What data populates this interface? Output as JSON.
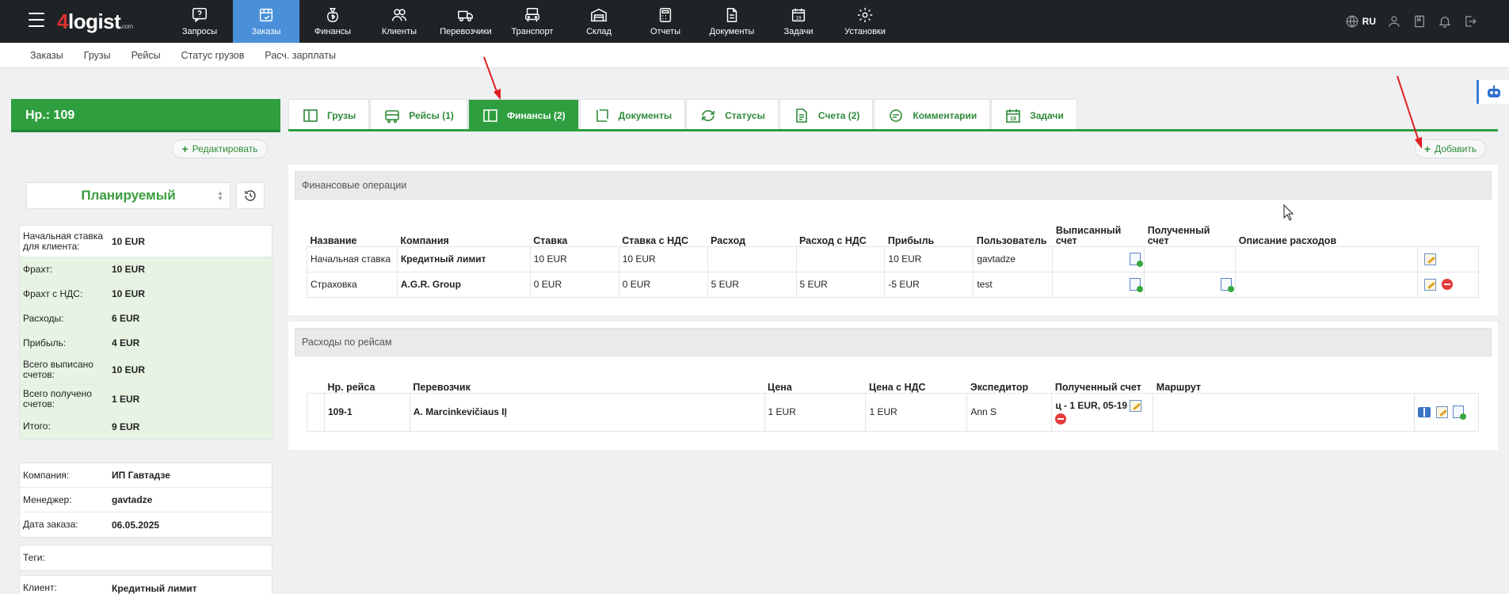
{
  "app": {
    "logo_num": "4",
    "logo_text": "logist",
    "logo_suffix": ".com",
    "lang": "RU"
  },
  "nav": [
    {
      "label": "Запросы",
      "icon": "chat-question-icon",
      "active": false
    },
    {
      "label": "Заказы",
      "icon": "order-box-icon",
      "active": true
    },
    {
      "label": "Финансы",
      "icon": "money-bag-icon",
      "active": false
    },
    {
      "label": "Клиенты",
      "icon": "users-icon",
      "active": false
    },
    {
      "label": "Перевозчики",
      "icon": "truck-icon",
      "active": false
    },
    {
      "label": "Транспорт",
      "icon": "vehicle-icon",
      "active": false
    },
    {
      "label": "Склад",
      "icon": "warehouse-icon",
      "active": false
    },
    {
      "label": "Отчеты",
      "icon": "calculator-icon",
      "active": false
    },
    {
      "label": "Документы",
      "icon": "document-icon",
      "active": false
    },
    {
      "label": "Задачи",
      "icon": "calendar-icon",
      "active": false
    },
    {
      "label": "Установки",
      "icon": "gear-icon",
      "active": false
    }
  ],
  "subnav": [
    "Заказы",
    "Грузы",
    "Рейсы",
    "Статус грузов",
    "Расч. зарплаты"
  ],
  "order": {
    "title": "Нр.: 109",
    "edit_label": "Редактировать",
    "status": "Планируемый"
  },
  "finance_summary": [
    {
      "label": "Начальная ставка для клиента:",
      "value": "10 EUR",
      "green": false
    },
    {
      "label": "Фрахт:",
      "value": "10 EUR",
      "green": true
    },
    {
      "label": "Фрахт с НДС:",
      "value": "10 EUR",
      "green": true
    },
    {
      "label": "Расходы:",
      "value": "6 EUR",
      "green": true
    },
    {
      "label": "Прибыль:",
      "value": "4 EUR",
      "green": true
    },
    {
      "label": "Всего выписано счетов:",
      "value": "10 EUR",
      "green": true
    },
    {
      "label": "Всего получено счетов:",
      "value": "1 EUR",
      "green": true
    },
    {
      "label": "Итого:",
      "value": "9 EUR",
      "green": true
    }
  ],
  "order_info": [
    {
      "label": "Компания:",
      "value": "ИП Гавтадзе"
    },
    {
      "label": "Менеджер:",
      "value": "gavtadze"
    },
    {
      "label": "Дата заказа:",
      "value": "06.05.2025"
    }
  ],
  "tags": {
    "label": "Теги:",
    "value": ""
  },
  "client": {
    "label": "Клиент:",
    "value": "Кредитный лимит"
  },
  "tabs": [
    {
      "label": "Грузы",
      "icon": "cargo-icon",
      "active": false
    },
    {
      "label": "Рейсы (1)",
      "icon": "bus-icon",
      "active": false
    },
    {
      "label": "Финансы (2)",
      "icon": "finance-panel-icon",
      "active": true
    },
    {
      "label": "Документы",
      "icon": "documents-icon",
      "active": false
    },
    {
      "label": "Статусы",
      "icon": "refresh-icon",
      "active": false
    },
    {
      "label": "Счета (2)",
      "icon": "invoice-icon",
      "active": false
    },
    {
      "label": "Комментарии",
      "icon": "comment-icon",
      "active": false
    },
    {
      "label": "Задачи",
      "icon": "calendar-19-icon",
      "active": false
    }
  ],
  "add_label": "Добавить",
  "fin_ops": {
    "title": "Финансовые операции",
    "headers": [
      "Название",
      "Компания",
      "Ставка",
      "Ставка с НДС",
      "Расход",
      "Расход с НДС",
      "Прибыль",
      "Пользователь",
      "Выписанный счет",
      "Полученный счет",
      "Описание расходов",
      ""
    ],
    "rows": [
      {
        "name": "Начальная ставка",
        "company": "Кредитный лимит",
        "rate": "10 EUR",
        "rate_vat": "10 EUR",
        "expense": "",
        "expense_vat": "",
        "profit": "10 EUR",
        "user": "gavtadze",
        "issued_icon": true,
        "received_icon": false,
        "desc": "",
        "delete": false
      },
      {
        "name": "Страховка",
        "company": "A.G.R. Group",
        "rate": "0 EUR",
        "rate_vat": "0 EUR",
        "expense": "5 EUR",
        "expense_vat": "5 EUR",
        "profit": "-5 EUR",
        "user": "test",
        "issued_icon": true,
        "received_icon": true,
        "desc": "",
        "delete": true
      }
    ]
  },
  "trip_expenses": {
    "title": "Расходы по рейсам",
    "headers": [
      "",
      "Нр. рейса",
      "Перевозчик",
      "Цена",
      "Цена с НДС",
      "Экспедитор",
      "Полученный счет",
      "Маршрут",
      ""
    ],
    "rows": [
      {
        "trip": "109-1",
        "carrier": "A. Marcinkevičiaus IĮ",
        "price": "1 EUR",
        "price_vat": "1 EUR",
        "forwarder": "Ann S",
        "invoice": "ц - 1 EUR, 05-19",
        "route": ""
      }
    ]
  }
}
